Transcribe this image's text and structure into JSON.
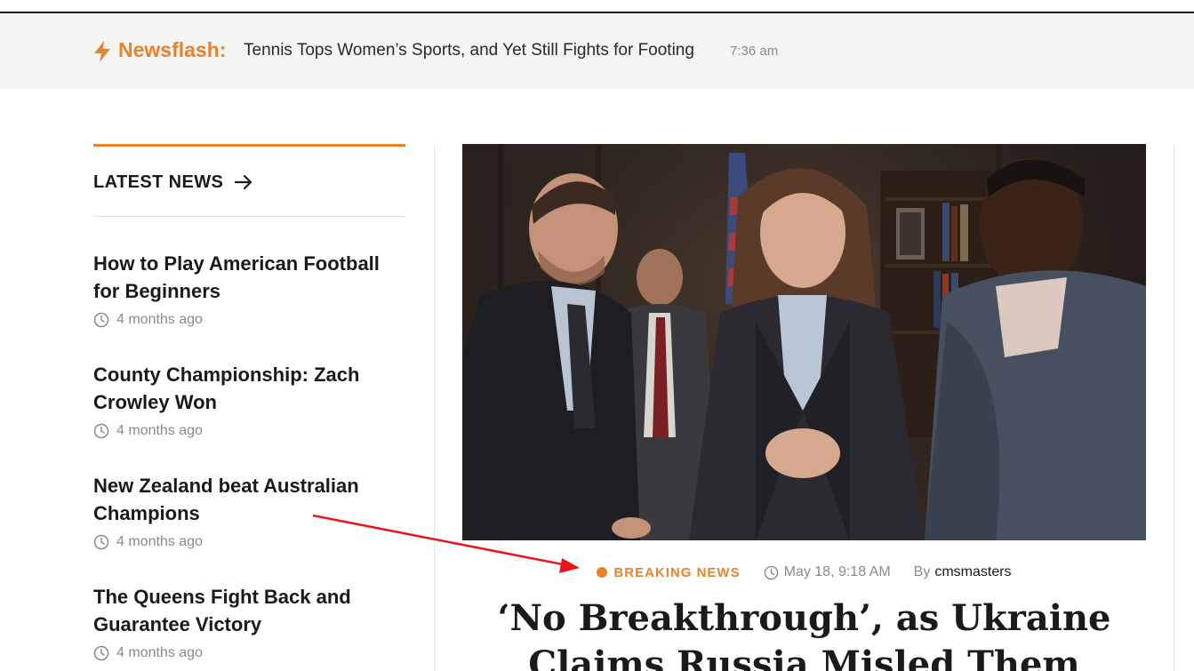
{
  "newsflash": {
    "label": "Newsflash:",
    "headline": "Tennis Tops Women’s Sports, and Yet Still Fights for Footing",
    "time": "7:36 am",
    "icon": "lightning-icon",
    "accent_color": "#e8832c"
  },
  "sidebar": {
    "title": "LATEST NEWS",
    "title_icon": "arrow-right-icon",
    "items": [
      {
        "title": "How to Play American Football for Beginners",
        "time": "4 months ago"
      },
      {
        "title": "County Championship: Zach Crowley Won",
        "time": "4 months ago"
      },
      {
        "title": "New Zealand beat Australian Champions",
        "time": "4 months ago"
      },
      {
        "title": "The Queens Fight Back and Guarantee Victory",
        "time": "4 months ago"
      }
    ]
  },
  "featured": {
    "category": "BREAKING NEWS",
    "date": "May 18, 9:18 AM",
    "by_label": "By",
    "author": "cmsmasters",
    "headline": "‘No Breakthrough’, as Ukraine Claims Russia Misled Them"
  },
  "annotation": {
    "type": "red-arrow",
    "color": "#e8151b"
  }
}
